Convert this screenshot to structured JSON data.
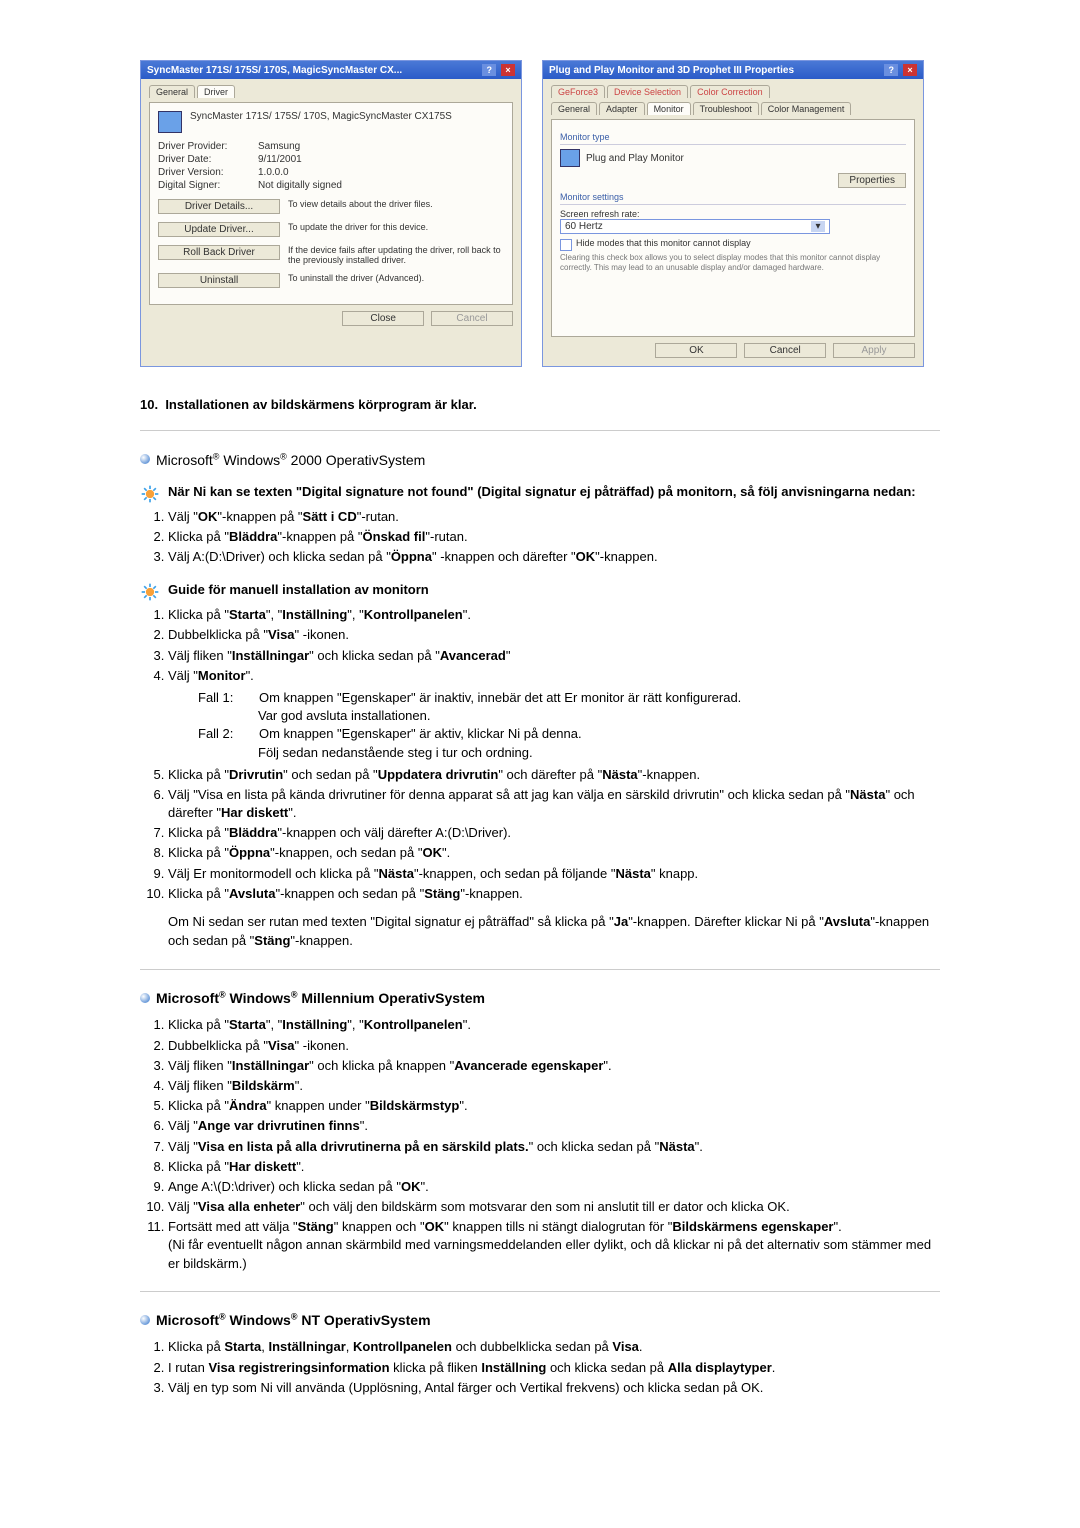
{
  "dialog_left": {
    "title": "SyncMaster 171S/ 175S/ 170S, MagicSyncMaster CX...",
    "tabs": [
      "General",
      "Driver"
    ],
    "active_tab": "Driver",
    "device": "SyncMaster 171S/ 175S/ 170S, MagicSyncMaster CX175S",
    "provider_label": "Driver Provider:",
    "provider": "Samsung",
    "date_label": "Driver Date:",
    "date": "9/11/2001",
    "version_label": "Driver Version:",
    "version": "1.0.0.0",
    "signer_label": "Digital Signer:",
    "signer": "Not digitally signed",
    "btn_details": "Driver Details...",
    "btn_details_desc": "To view details about the driver files.",
    "btn_update": "Update Driver...",
    "btn_update_desc": "To update the driver for this device.",
    "btn_rollback": "Roll Back Driver",
    "btn_rollback_desc": "If the device fails after updating the driver, roll back to the previously installed driver.",
    "btn_uninstall": "Uninstall",
    "btn_uninstall_desc": "To uninstall the driver (Advanced).",
    "footer_ok": "Close",
    "footer_cancel": "Cancel"
  },
  "dialog_right": {
    "title": "Plug and Play Monitor and 3D Prophet III Properties",
    "tabs_top": [
      "GeForce3",
      "Device Selection",
      "Color Correction"
    ],
    "tabs_bottom": [
      "General",
      "Adapter",
      "Monitor",
      "Troubleshoot",
      "Color Management"
    ],
    "active_tab": "Monitor",
    "group_type": "Monitor type",
    "monitor_name": "Plug and Play Monitor",
    "btn_properties": "Properties",
    "group_settings": "Monitor settings",
    "refresh_label": "Screen refresh rate:",
    "refresh_value": "60 Hertz",
    "checkbox_label": "Hide modes that this monitor cannot display",
    "checkbox_note": "Clearing this check box allows you to select display modes that this monitor cannot display correctly. This may lead to an unusable display and/or damaged hardware.",
    "footer_ok": "OK",
    "footer_cancel": "Cancel",
    "footer_apply": "Apply"
  },
  "step10_num": "10.",
  "step10": "Installationen av bildskärmens körprogram är klar.",
  "os_2000": "Microsoft® Windows® 2000 OperativSystem",
  "sig_head": "När Ni kan se texten \"Digital signature not found\" (Digital signatur ej påträffad) på monitorn, så följ anvisningarna nedan:",
  "sig_steps": [
    "Välj \"<b>OK</b>\"-knappen på \"<b>Sätt i CD</b>\"-rutan.",
    "Klicka på \"<b>Bläddra</b>\"-knappen på \"<b>Önskad fil</b>\"-rutan.",
    "Välj A:(D:\\Driver) och klicka sedan på \"<b>Öppna</b>\" -knappen och därefter \"<b>OK</b>\"-knappen."
  ],
  "guide_head": "Guide för manuell installation av monitorn",
  "guide_steps": [
    "Klicka på \"<b>Starta</b>\", \"<b>Inställning</b>\", \"<b>Kontrollpanelen</b>\".",
    "Dubbelklicka på \"<b>Visa</b>\" -ikonen.",
    "Välj fliken \"<b>Inställningar</b>\" och klicka sedan på \"<b>Avancerad</b>\"",
    "Välj \"<b>Monitor</b>\".",
    "Klicka på \"<b>Drivrutin</b>\" och sedan på \"<b>Uppdatera drivrutin</b>\" och därefter på \"<b>Nästa</b>\"-knappen.",
    "Välj \"Visa en lista på kända drivrutiner för denna apparat så att jag kan välja en särskild drivrutin\" och klicka sedan på \"<b>Nästa</b>\" och därefter \"<b>Har diskett</b>\".",
    "Klicka på \"<b>Bläddra</b>\"-knappen och välj därefter A:(D:\\Driver).",
    "Klicka på \"<b>Öppna</b>\"-knappen, och sedan på \"<b>OK</b>\".",
    "Välj Er monitormodell och klicka på \"<b>Nästa</b>\"-knappen, och sedan på följande \"<b>Nästa</b>\" knapp.",
    "Klicka på \"<b>Avsluta</b>\"-knappen och sedan på \"<b>Stäng</b>\"-knappen."
  ],
  "fall1_label": "Fall 1:",
  "fall1_a": "Om knappen \"Egenskaper\" är inaktiv, innebär det att Er monitor är rätt konfigurerad.",
  "fall1_b": "Var god avsluta installationen.",
  "fall2_label": "Fall 2:",
  "fall2_a": "Om knappen \"Egenskaper\" är aktiv, klickar Ni på denna.",
  "fall2_b": "Följ sedan nedanstående steg i tur och ordning.",
  "guide_tail": "Om Ni sedan ser rutan med texten \"Digital signatur ej påträffad\" så klicka på \"<b>Ja</b>\"-knappen. Därefter klickar Ni på \"<b>Avsluta</b>\"-knappen och sedan på \"<b>Stäng</b>\"-knappen.",
  "os_me": "Microsoft® Windows® Millennium OperativSystem",
  "me_steps": [
    "Klicka på \"<b>Starta</b>\", \"<b>Inställning</b>\", \"<b>Kontrollpanelen</b>\".",
    "Dubbelklicka på \"<b>Visa</b>\" -ikonen.",
    "Välj fliken \"<b>Inställningar</b>\" och klicka på knappen \"<b>Avancerade egenskaper</b>\".",
    "Välj fliken \"<b>Bildskärm</b>\".",
    "Klicka på \"<b>Ändra</b>\" knappen under \"<b>Bildskärmstyp</b>\".",
    "Välj \"<b>Ange var drivrutinen finns</b>\".",
    "Välj \"<b>Visa en lista på alla drivrutinerna på en särskild plats.</b>\" och klicka sedan på \"<b>Nästa</b>\".",
    "Klicka på \"<b>Har diskett</b>\".",
    "Ange A:\\(D:\\driver) och klicka sedan på \"<b>OK</b>\".",
    "Välj \"<b>Visa alla enheter</b>\" och välj den bildskärm som motsvarar den som ni anslutit till er dator och klicka OK.",
    "Fortsätt med att välja \"<b>Stäng</b>\" knappen och \"<b>OK</b>\" knappen tills ni stängt dialogrutan för \"<b>Bildskärmens egenskaper</b>\".<br>(Ni får eventuellt någon annan skärmbild med varningsmeddelanden eller dylikt, och då klickar ni på det alternativ som stämmer med er bildskärm.)"
  ],
  "os_nt": "Microsoft® Windows® NT OperativSystem",
  "nt_steps": [
    "Klicka på <b>Starta</b>, <b>Inställningar</b>, <b>Kontrollpanelen</b> och dubbelklicka sedan på <b>Visa</b>.",
    "I rutan <b>Visa registreringsinformation</b> klicka på fliken <b>Inställning</b> och klicka sedan på <b>Alla displaytyper</b>.",
    "Välj en typ som Ni vill använda (Upplösning, Antal färger och Vertikal frekvens) och klicka sedan på OK."
  ]
}
